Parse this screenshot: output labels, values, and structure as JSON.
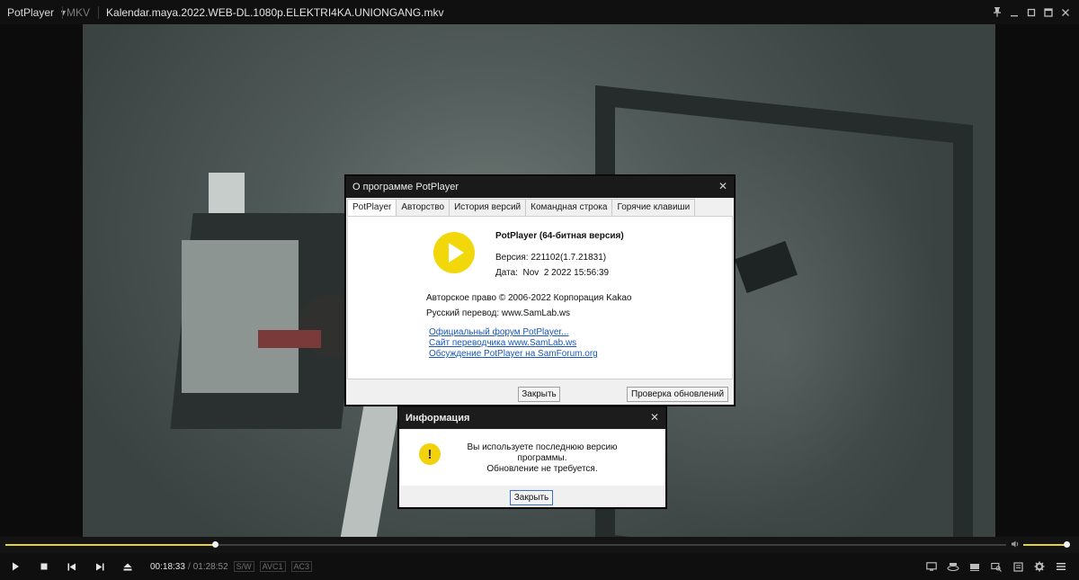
{
  "app": {
    "brand": "PotPlayer",
    "format": "MKV",
    "title": "Kalendar.maya.2022.WEB-DL.1080p.ELEKTRI4KA.UNIONGANG.mkv"
  },
  "window_controls": [
    "pin-icon",
    "minimize-icon",
    "restore-icon",
    "maximize-icon",
    "close-icon"
  ],
  "about_dialog": {
    "title": "О программе PotPlayer",
    "tabs": [
      {
        "label": "PotPlayer",
        "active": true
      },
      {
        "label": "Авторство",
        "active": false
      },
      {
        "label": "История версий",
        "active": false
      },
      {
        "label": "Командная строка",
        "active": false
      },
      {
        "label": "Горячие клавиши",
        "active": false
      }
    ],
    "product": "PotPlayer (64-битная версия)",
    "version": "Версия: 221102(1.7.21831)",
    "date": "Дата:  Nov  2 2022 15:56:39",
    "copyright": "Авторское право © 2006-2022 Корпорация Kakao",
    "translation": "Русский перевод: www.SamLab.ws",
    "links": [
      "Официальный форум PotPlayer...",
      "Сайт переводчика www.SamLab.ws",
      "Обсуждение PotPlayer на SamForum.org"
    ],
    "close_label": "Закрыть",
    "check_updates_label": "Проверка обновлений"
  },
  "info_dialog": {
    "title": "Информация",
    "message_line1": "Вы используете последнюю версию программы.",
    "message_line2": "Обновление не требуется.",
    "close_label": "Закрыть"
  },
  "playback": {
    "current_time": "00:18:33",
    "separator": "/",
    "total_time": "01:28:52",
    "progress": 0.209,
    "volume": 1.0,
    "tags": [
      "S/W",
      "AVC1",
      "AC3"
    ]
  },
  "colors": {
    "accent": "#e4d23c",
    "logo": "#f2d80a",
    "link": "#1a57b8"
  }
}
